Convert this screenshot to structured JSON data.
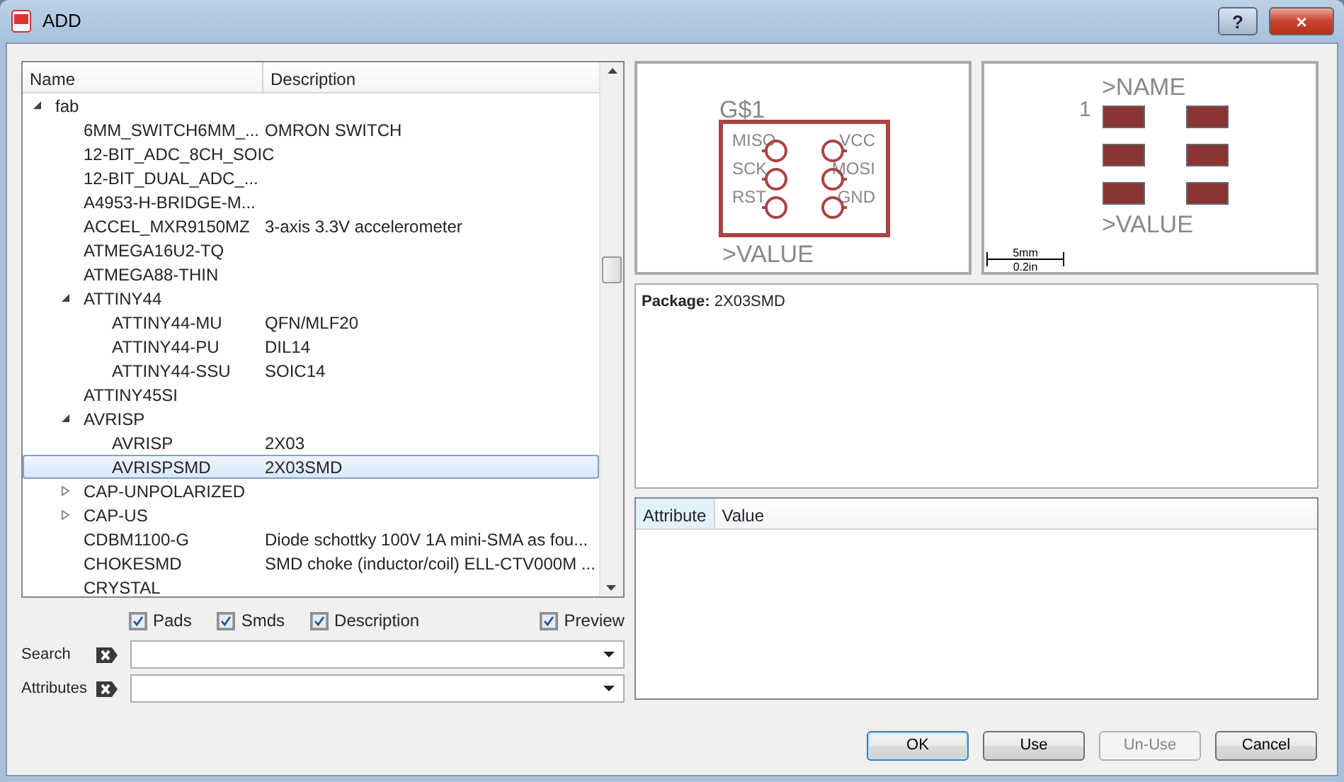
{
  "window": {
    "title": "ADD",
    "help": "?",
    "close": "×"
  },
  "tree": {
    "columns": [
      "Name",
      "Description"
    ],
    "rows": [
      {
        "name": "fab",
        "expanded": true,
        "selected": false,
        "children": [
          {
            "name": "6MM_SWITCH6MM_...",
            "description": "OMRON SWITCH",
            "selected": false
          },
          {
            "name": "12-BIT_ADC_8CH_SOIC",
            "selected": false
          },
          {
            "name": "12-BIT_DUAL_ADC_...",
            "selected": false
          },
          {
            "name": "A4953-H-BRIDGE-M...",
            "selected": false
          },
          {
            "name": "ACCEL_MXR9150MZ",
            "description": "3-axis 3.3V accelerometer",
            "selected": false
          },
          {
            "name": "ATMEGA16U2-TQ",
            "selected": false
          },
          {
            "name": "ATMEGA88-THIN",
            "selected": false
          },
          {
            "name": "ATTINY44",
            "expanded": true,
            "selected": false,
            "children": [
              {
                "name": "ATTINY44-MU",
                "description": "QFN/MLF20",
                "selected": false
              },
              {
                "name": "ATTINY44-PU",
                "description": "DIL14",
                "selected": false
              },
              {
                "name": "ATTINY44-SSU",
                "description": "SOIC14",
                "selected": false
              }
            ]
          },
          {
            "name": "ATTINY45SI",
            "selected": false
          },
          {
            "name": "AVRISP",
            "expanded": true,
            "selected": false,
            "children": [
              {
                "name": "AVRISP",
                "description": "2X03",
                "selected": false
              },
              {
                "name": "AVRISPSMD",
                "description": "2X03SMD",
                "selected": true
              }
            ]
          },
          {
            "name": "CAP-UNPOLARIZED",
            "expanded": false,
            "selected": false
          },
          {
            "name": "CAP-US",
            "expanded": false,
            "selected": false
          },
          {
            "name": "CDBM1100-G",
            "description": "Diode schottky 100V 1A mini-SMA as fou...",
            "selected": false
          },
          {
            "name": "CHOKESMD",
            "description": "SMD choke (inductor/coil) ELL-CTV000M ...",
            "selected": false
          },
          {
            "name": "CRYSTAL",
            "selected": false
          }
        ]
      }
    ]
  },
  "filters": [
    {
      "label": "Pads",
      "checked": true
    },
    {
      "label": "Smds",
      "checked": true
    },
    {
      "label": "Description",
      "checked": true
    },
    {
      "label": "Preview",
      "checked": true
    }
  ],
  "fields": [
    {
      "label": "Search"
    },
    {
      "label": "Attributes"
    }
  ],
  "symbol_preview": {
    "name": "G$1",
    "value": ">VALUE",
    "left_pins": [
      "MISO",
      "SCK",
      "RST"
    ],
    "right_pins": [
      "VCC",
      "MOSI",
      "GND"
    ]
  },
  "package_preview": {
    "name": ">NAME",
    "pin_one": "1",
    "value": ">VALUE",
    "scale_metric": "5mm",
    "scale_imperial": "0.2in"
  },
  "description": {
    "label": "Package:",
    "value": "2X03SMD"
  },
  "attributes_table": {
    "columns": [
      "Attribute",
      "Value"
    ]
  },
  "buttons": [
    {
      "label": "OK",
      "default": true,
      "disabled": false
    },
    {
      "label": "Use",
      "default": false,
      "disabled": false
    },
    {
      "label": "Un-Use",
      "default": false,
      "disabled": true
    },
    {
      "label": "Cancel",
      "default": false,
      "disabled": false
    }
  ]
}
